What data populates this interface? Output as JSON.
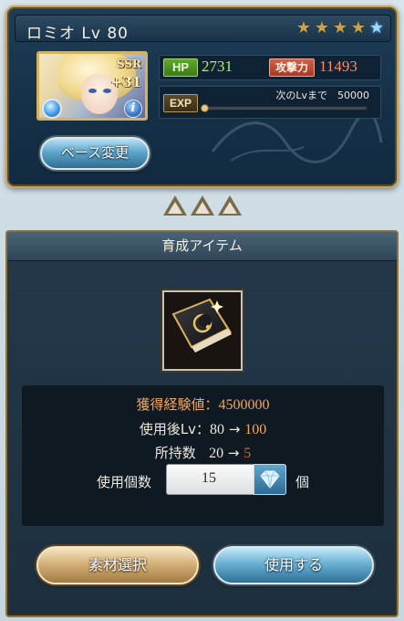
{
  "character": {
    "name": "ロミオ",
    "level_label": "Lv 80",
    "rarity": "SSR",
    "plus": "+31",
    "stars_filled": 4,
    "stars_total": 5,
    "hp_label": "HP",
    "hp_value": "2731",
    "atk_label": "攻撃力",
    "atk_value": "11493",
    "exp_label": "EXP",
    "next_level_text": "次のLvまで　50000",
    "exp_progress": 0.0,
    "base_change_label": "ベース変更"
  },
  "item_panel": {
    "header": "育成アイテム",
    "gain_label": "獲得経験値：",
    "gain_value": "4500000",
    "after_lv_label": "使用後Lv：",
    "after_lv_from": "80",
    "after_lv_arrow": "→",
    "after_lv_to": "100",
    "owned_label": "所持数",
    "owned_from": "20",
    "owned_arrow": "→",
    "owned_to": "5",
    "count_label": "使用個数",
    "count_value": "15",
    "count_unit": "個",
    "material_button": "素材選択",
    "use_button": "使用する"
  },
  "colors": {
    "accent_gold": "#c7a35d",
    "hp_green": "#a9f06b",
    "atk_red": "#ff8a6b",
    "highlight_orange": "#f3a65a",
    "decrease_red": "#e45a3a"
  },
  "icons": [
    "star-icon",
    "element-water-icon",
    "info-icon",
    "book-item-icon",
    "gem-dropdown-icon",
    "triangle-arrow-icon"
  ]
}
